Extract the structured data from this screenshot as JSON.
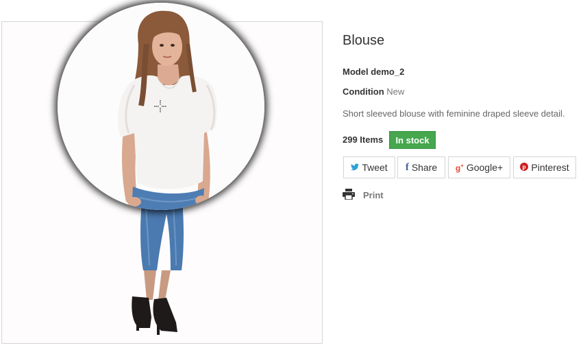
{
  "product": {
    "title": "Blouse",
    "model_label": "Model",
    "model_value": "demo_2",
    "condition_label": "Condition",
    "condition_value": "New",
    "description": "Short sleeved blouse with feminine draped sleeve detail.",
    "quantity": "299 Items",
    "stock_status": "In stock"
  },
  "social": {
    "tweet": "Tweet",
    "share": "Share",
    "google": "Google+",
    "pinterest": "Pinterest"
  },
  "actions": {
    "print": "Print"
  },
  "colors": {
    "stock_badge": "#46a74e",
    "twitter": "#2f9fd8",
    "facebook": "#435f9f",
    "google": "#e04b34",
    "pinterest": "#ce1f21"
  },
  "icons": {
    "tweet": "twitter-icon",
    "share": "facebook-icon",
    "google": "google-plus-icon",
    "pinterest": "pinterest-icon",
    "print": "printer-icon",
    "cursor": "crosshair-cursor-icon"
  }
}
